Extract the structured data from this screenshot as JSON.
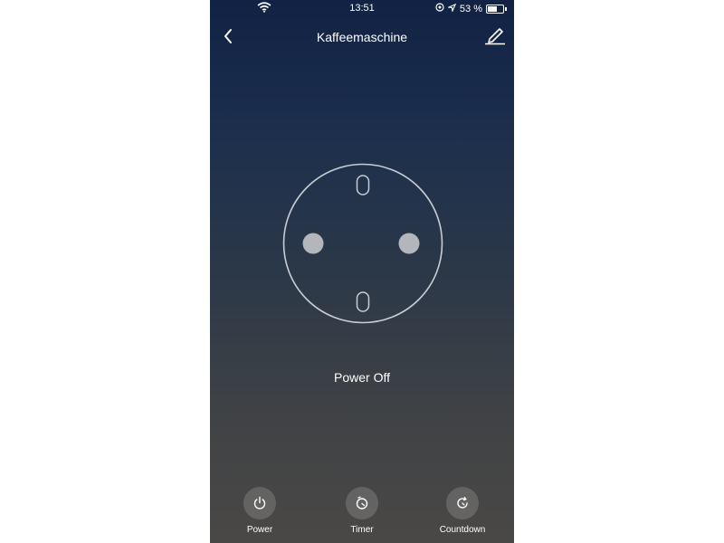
{
  "status_bar": {
    "time": "13:51",
    "battery": "53 %",
    "battery_level": 0.53,
    "icons": [
      "wifi-icon",
      "lock-rotation-icon",
      "location-icon",
      "battery-icon"
    ]
  },
  "header": {
    "title": "Kaffeemaschine",
    "back_icon": "chevron-left-icon",
    "edit_icon": "edit-icon"
  },
  "device": {
    "status": "Power Off",
    "icon": "schuko-socket-icon"
  },
  "controls": [
    {
      "label": "Power",
      "icon": "power-icon"
    },
    {
      "label": "Timer",
      "icon": "timer-icon"
    },
    {
      "label": "Countdown",
      "icon": "countdown-icon"
    }
  ]
}
